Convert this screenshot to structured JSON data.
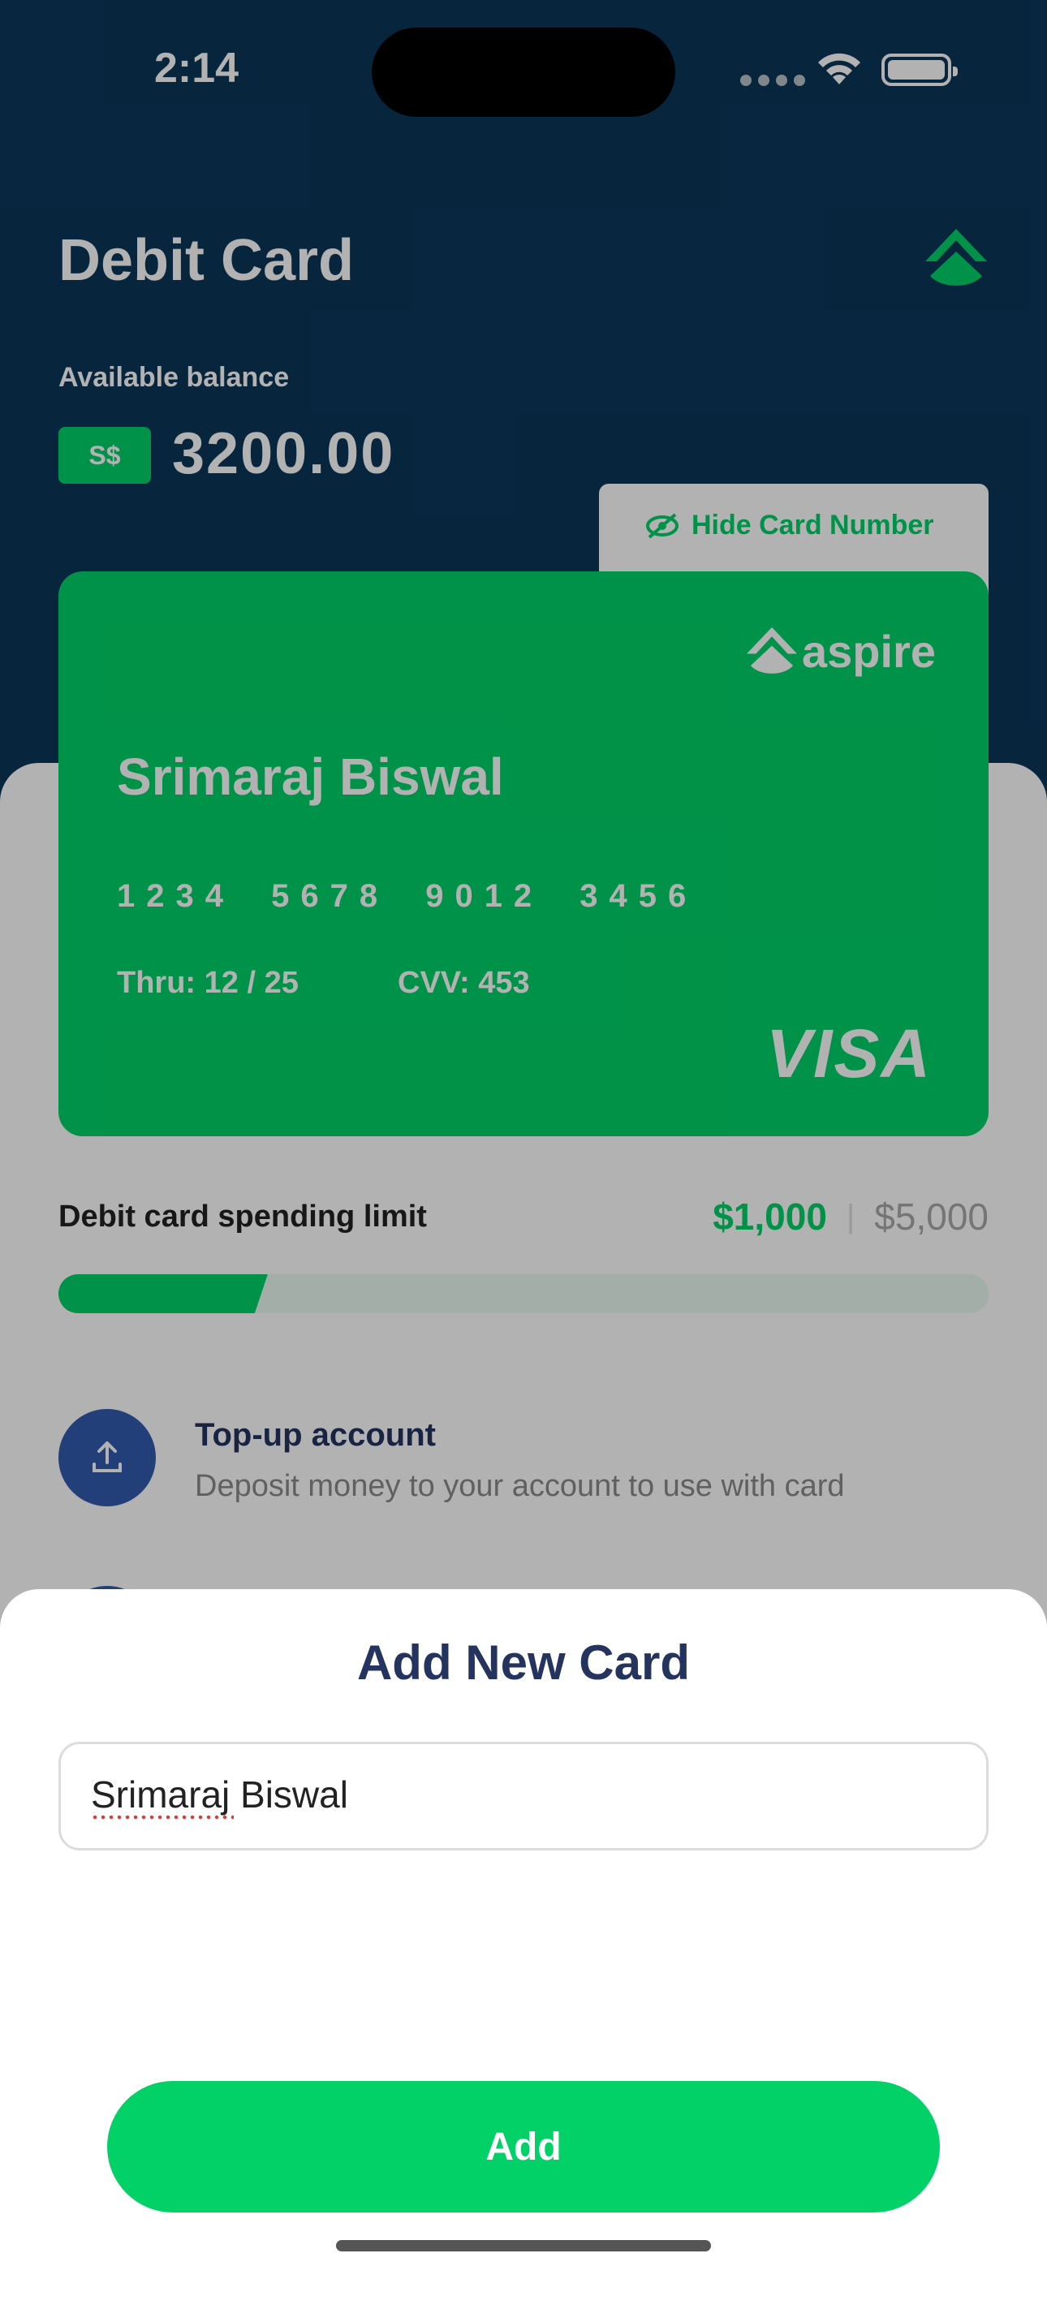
{
  "status_bar": {
    "time": "2:14"
  },
  "header": {
    "title": "Debit Card",
    "balance_label": "Available balance",
    "currency": "S$",
    "balance": "3200.00",
    "hide_card_label": "Hide Card Number"
  },
  "card": {
    "brand": "aspire",
    "holder_name": "Srimaraj Biswal",
    "number": "1234 5678 9012 3456",
    "expiry": "Thru: 12 / 25",
    "cvv": "CVV:  453",
    "network": "VISA"
  },
  "spending_limit": {
    "label": "Debit card spending limit",
    "used": "$1,000",
    "separator": "|",
    "max": "$5,000",
    "progress_fraction": 0.225
  },
  "menu": {
    "items": [
      {
        "title": "Top-up account",
        "subtitle": "Deposit money to your account to use with card"
      }
    ]
  },
  "sheet": {
    "title": "Add New Card",
    "name_value": "Srimaraj Biswal",
    "add_label": "Add"
  },
  "colors": {
    "accent": "#01d167",
    "header_bg": "#0c365a",
    "icon_bg": "#325baf",
    "title_text": "#25345f"
  }
}
